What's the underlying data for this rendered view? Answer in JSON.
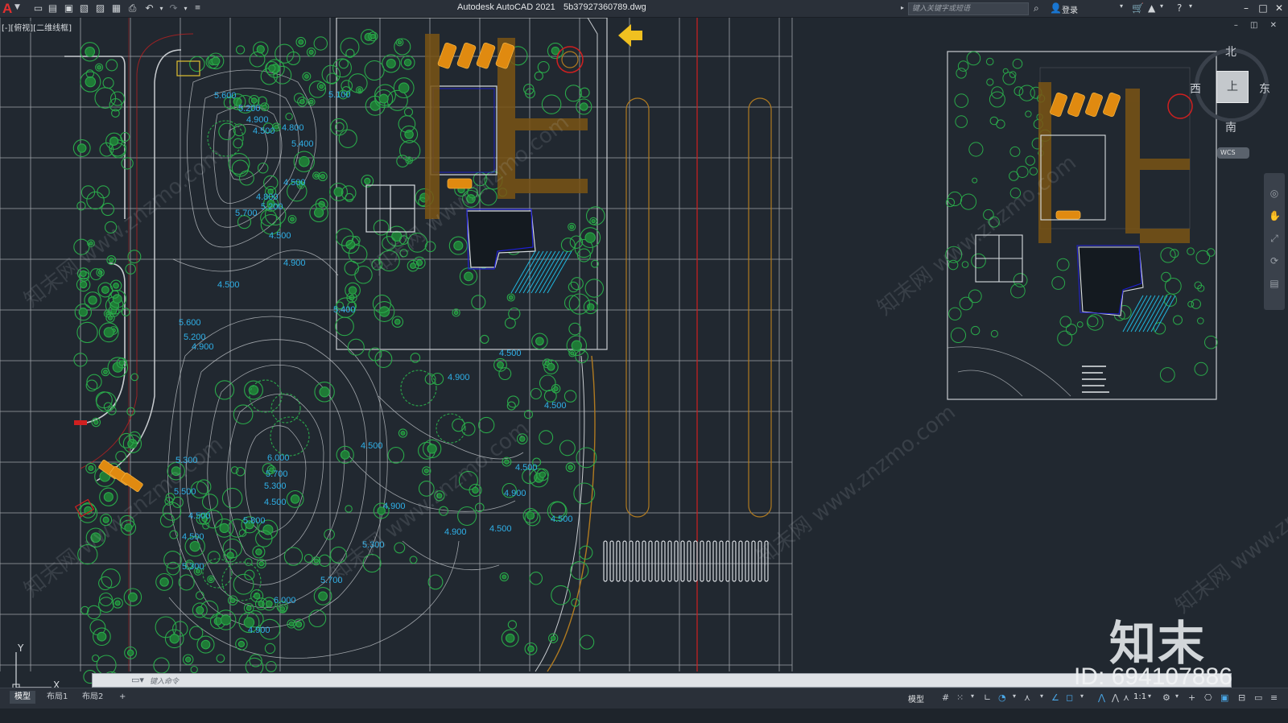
{
  "app": {
    "title": "Autodesk AutoCAD 2021",
    "filename": "5b37927360789.dwg"
  },
  "search": {
    "placeholder": "键入关键字或短语"
  },
  "user": {
    "login_label": "登录"
  },
  "viewport": {
    "label": "[-][俯视][二维线框]"
  },
  "viewcube": {
    "face": "上",
    "north": "北",
    "south": "南",
    "east": "东",
    "west": "西",
    "wcs_label": "WCS"
  },
  "ucs": {
    "x_label": "X",
    "y_label": "Y"
  },
  "command_line": {
    "placeholder": "键入命令"
  },
  "layout_tabs": [
    "模型",
    "布局1",
    "布局2"
  ],
  "status_bar": {
    "model_label": "模型",
    "scale": "1:1"
  },
  "watermarks": {
    "brand": "知末",
    "id": "ID: 694107886",
    "url": "知末网 www.znzmo.com"
  },
  "elevations": [
    "5.600",
    "5.200",
    "4.900",
    "4.500",
    "4.800",
    "5.400",
    "4.500",
    "4.800",
    "5.200",
    "5.700",
    "4.500",
    "4.900",
    "4.500",
    "5.400",
    "5.600",
    "5.200",
    "4.900",
    "5.100",
    "4.500",
    "4.900",
    "4.500",
    "4.500",
    "6.000",
    "5.700",
    "5.300",
    "4.500",
    "4.900",
    "5.300",
    "5.500",
    "4.500",
    "5.800",
    "4.500",
    "4.900",
    "4.500",
    "4.500",
    "4.900",
    "5.300",
    "5.300",
    "5.700",
    "6.000",
    "4.900",
    "4.500"
  ],
  "colors": {
    "background": "#212830",
    "grid": "#c8ccd0",
    "elevation_text": "#2fb0e8",
    "vegetation": "#2aa84a",
    "paving": "#b07a20",
    "building": "#d8dce0",
    "red_line": "#d02020"
  }
}
